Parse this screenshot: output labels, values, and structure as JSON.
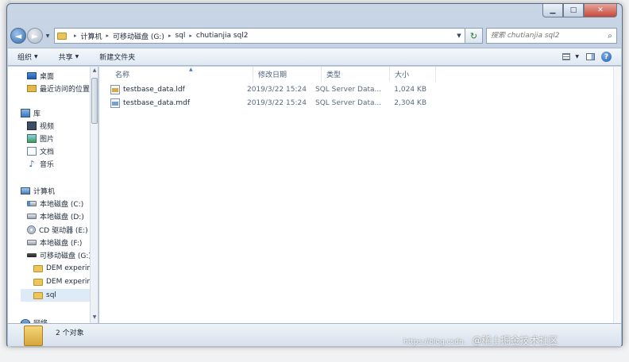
{
  "window": {
    "caption": {
      "minimize": "▁",
      "maximize": "□",
      "close": "✕"
    }
  },
  "address": {
    "back": "◄",
    "forward": "►",
    "crumbs": [
      "计算机",
      "可移动磁盘 (G:)",
      "sql",
      "chutianjia sql2"
    ],
    "refresh": "↻",
    "search_placeholder": "搜索 chutianjia sql2",
    "search_icon": "search-icon"
  },
  "toolbar": {
    "organize": "组织",
    "share": "共享",
    "new_folder": "新建文件夹"
  },
  "nav": {
    "favorites": [
      {
        "label": "桌面",
        "icon": "desktop-icon"
      },
      {
        "label": "最近访问的位置",
        "icon": "recent-places-icon"
      }
    ],
    "libraries": {
      "label": "库",
      "items": [
        {
          "label": "视频",
          "icon": "video-library-icon"
        },
        {
          "label": "图片",
          "icon": "picture-library-icon"
        },
        {
          "label": "文档",
          "icon": "document-library-icon"
        },
        {
          "label": "音乐",
          "icon": "music-library-icon"
        }
      ]
    },
    "computer": {
      "label": "计算机",
      "items": [
        {
          "label": "本地磁盘 (C:)",
          "icon": "drive-c-icon"
        },
        {
          "label": "本地磁盘 (D:)",
          "icon": "drive-icon"
        },
        {
          "label": "CD 驱动器 (E:)",
          "icon": "cd-drive-icon"
        },
        {
          "label": "本地磁盘 (F:)",
          "icon": "drive-icon"
        },
        {
          "label": "可移动磁盘 (G:)",
          "icon": "usb-drive-icon"
        }
      ],
      "folders": [
        "DEM experim",
        "DEM experim",
        "sql"
      ]
    },
    "network": "网络"
  },
  "columns": {
    "name": "名称",
    "date": "修改日期",
    "type": "类型",
    "size": "大小"
  },
  "files": [
    {
      "name": "testbase_data.ldf",
      "date": "2019/3/22 15:24",
      "type": "SQL Server Data...",
      "size": "1,024 KB",
      "icon": "ldf-file-icon"
    },
    {
      "name": "testbase_data.mdf",
      "date": "2019/3/22 15:24",
      "type": "SQL Server Data...",
      "size": "2,304 KB",
      "icon": "mdf-file-icon"
    }
  ],
  "status": {
    "count": "2 个对象"
  },
  "watermark": {
    "url": "https://blog.csdn.",
    "text": "@稀土掘金技术社区"
  }
}
